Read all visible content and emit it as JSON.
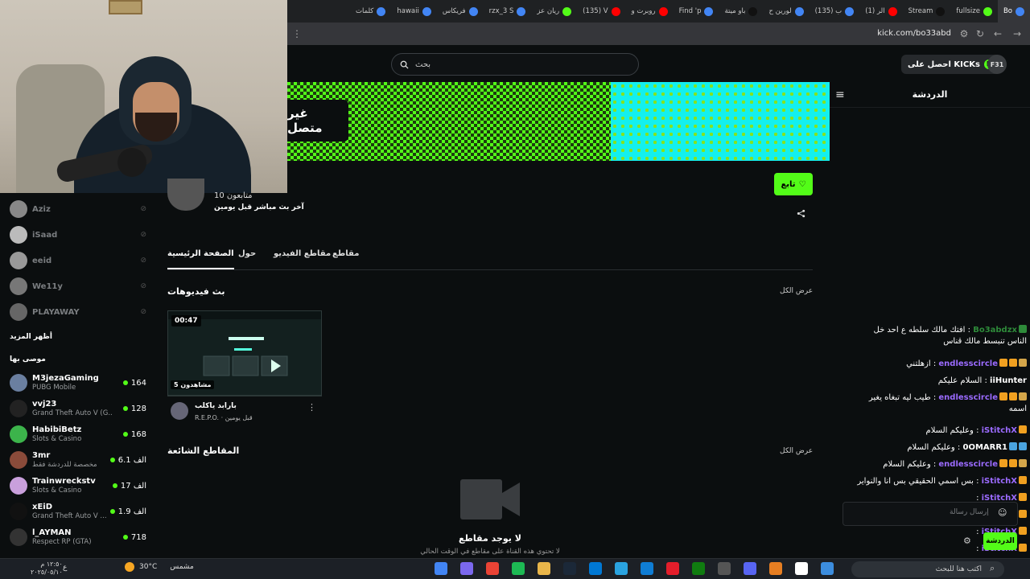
{
  "browser": {
    "tabs": [
      {
        "label": "كلمات",
        "color": "#4285f4"
      },
      {
        "label": "hawaii",
        "color": "#4285f4"
      },
      {
        "label": "فريكاس",
        "color": "#4285f4"
      },
      {
        "label": "rzx_3 S",
        "color": "#4285f4"
      },
      {
        "label": "ريان عز",
        "color": "#53fc18"
      },
      {
        "label": "(135) V",
        "color": "#ff0000"
      },
      {
        "label": "روبرت و",
        "color": "#ff0000"
      },
      {
        "label": "Find 'p",
        "color": "#4285f4"
      },
      {
        "label": "باو ميتة",
        "color": "#111111"
      },
      {
        "label": "لورين ح",
        "color": "#4285f4"
      },
      {
        "label": "(135) ب",
        "color": "#4285f4"
      },
      {
        "label": "(1) الر",
        "color": "#ff0000"
      },
      {
        "label": "Stream",
        "color": "#111111"
      },
      {
        "label": "fullsize",
        "color": "#53fc18"
      },
      {
        "label": "Bo",
        "color": "#4285f4"
      }
    ],
    "url": "kick.com/bo33abd"
  },
  "header": {
    "search_placeholder": "بحث",
    "get_kicks": "احصل على KICKs",
    "avatar_text": "F31"
  },
  "banner": {
    "offline_label": "غير متصل"
  },
  "chat": {
    "title": "الدردشة",
    "input_placeholder": "إرسال رسالة",
    "send_label": "الدردشة",
    "messages": [
      {
        "user": "Bo3abdzx",
        "text": "افتك مالك سلطه ع احد خل الناس تنبسط مالك قناس",
        "color": "#2e8b3a",
        "badges": [
          "#2e8b3a"
        ]
      },
      {
        "user": "endlesscircle",
        "text": "ازهلتني",
        "color": "#9b6bff",
        "badges": [
          "#d4a64a",
          "#f0a020",
          "#f0a020"
        ]
      },
      {
        "user": "iiHunter",
        "text": "السلام عليكم",
        "color": "#ffffff",
        "badges": []
      },
      {
        "user": "endlesscircle",
        "text": "طيب ليه تبغاه يغير اسمه",
        "color": "#9b6bff",
        "badges": [
          "#d4a64a",
          "#f0a020",
          "#f0a020"
        ]
      },
      {
        "user": "iStitchX",
        "text": "وعليكم السلام",
        "color": "#9b6bff",
        "badges": [
          "#f0a020"
        ]
      },
      {
        "user": "0OMARR1",
        "text": "وعليكم السلام",
        "color": "#ffffff",
        "badges": [
          "#4aa3df",
          "#4aa3df"
        ]
      },
      {
        "user": "endlesscircle",
        "text": "وعليكم السلام",
        "color": "#9b6bff",
        "badges": [
          "#d4a64a",
          "#f0a020",
          "#f0a020"
        ]
      },
      {
        "user": "iStitchX",
        "text": "بس اسمي الحقيقي بس انا والنواير",
        "color": "#9b6bff",
        "badges": [
          "#f0a020"
        ]
      },
      {
        "user": "iStitchX",
        "text": "",
        "color": "#9b6bff",
        "badges": [
          "#f0a020"
        ]
      },
      {
        "user": "iStitchX",
        "text": "",
        "color": "#9b6bff",
        "badges": [
          "#f0a020"
        ]
      },
      {
        "user": "iStitchX",
        "text": "",
        "color": "#9b6bff",
        "badges": [
          "#f0a020"
        ]
      },
      {
        "user": "iStitchX",
        "text": "",
        "color": "#9b6bff",
        "badges": [
          "#f0a020"
        ]
      }
    ]
  },
  "channel": {
    "followers": "10 متابعون",
    "last_live": "آخر بث مباشر قبل يومين",
    "follow_label": "تابع"
  },
  "tabs": {
    "home": "الصفحة الرئيسية",
    "about": "حول",
    "videos": "مقاطع الفيديو",
    "clips": "مقاطع"
  },
  "sections": {
    "vods_title": "بث فيديوهات",
    "view_all": "عرض الكل",
    "clips_title": "المقاطع الشائعة",
    "clips_view_all": "عرض الكل"
  },
  "vod": {
    "duration": "00:47",
    "views": "5 مشاهدون",
    "title": "بارابد ياكلب",
    "meta": "R.E.P.O. · قبل يومين"
  },
  "empty": {
    "title": "لا يوجد مقاطع",
    "desc": "لا تحتوي هذه القناة على مقاطع في الوقت الحالي"
  },
  "sidebar": {
    "offline": [
      {
        "name": "Aziz",
        "color": "#888888"
      },
      {
        "name": "iSaad",
        "color": "#bbbbbb"
      },
      {
        "name": "eeid",
        "color": "#999999"
      },
      {
        "name": "We11y",
        "color": "#777777"
      },
      {
        "name": "PLAYAWAY",
        "color": "#666666"
      }
    ],
    "show_more": "أظهر المزيد",
    "recommended": "موصى بها",
    "channels": [
      {
        "name": "M3jezaGaming",
        "category": "PUBG Mobile",
        "viewers": "164",
        "color": "#6a7fa0"
      },
      {
        "name": "vvj23",
        "category": "Grand Theft Auto V (G...",
        "viewers": "128",
        "color": "#222222"
      },
      {
        "name": "HabibiBetz",
        "category": "Slots & Casino",
        "viewers": "168",
        "color": "#3cb44b"
      },
      {
        "name": "3mr",
        "category": "مخصصة للدردشة فقط",
        "viewers": "6.1 الف",
        "color": "#8a4b3a"
      },
      {
        "name": "Trainwreckstv",
        "category": "Slots & Casino",
        "viewers": "17 الف",
        "color": "#c9a0dc"
      },
      {
        "name": "xEiD",
        "category": "Grand Theft Auto V ...",
        "viewers": "1.9 الف",
        "color": "#111111"
      },
      {
        "name": "l_AYMAN",
        "category": "Respect RP (GTA)",
        "viewers": "718",
        "color": "#333333"
      }
    ]
  },
  "taskbar": {
    "weather": "30°C",
    "weather_label": "مشمس",
    "time": "١٢:٥٠ م",
    "date": "٢٠٢٥/٠٥/١٠",
    "lang": "ع",
    "search_text": "اكتب هنا للبحث"
  }
}
